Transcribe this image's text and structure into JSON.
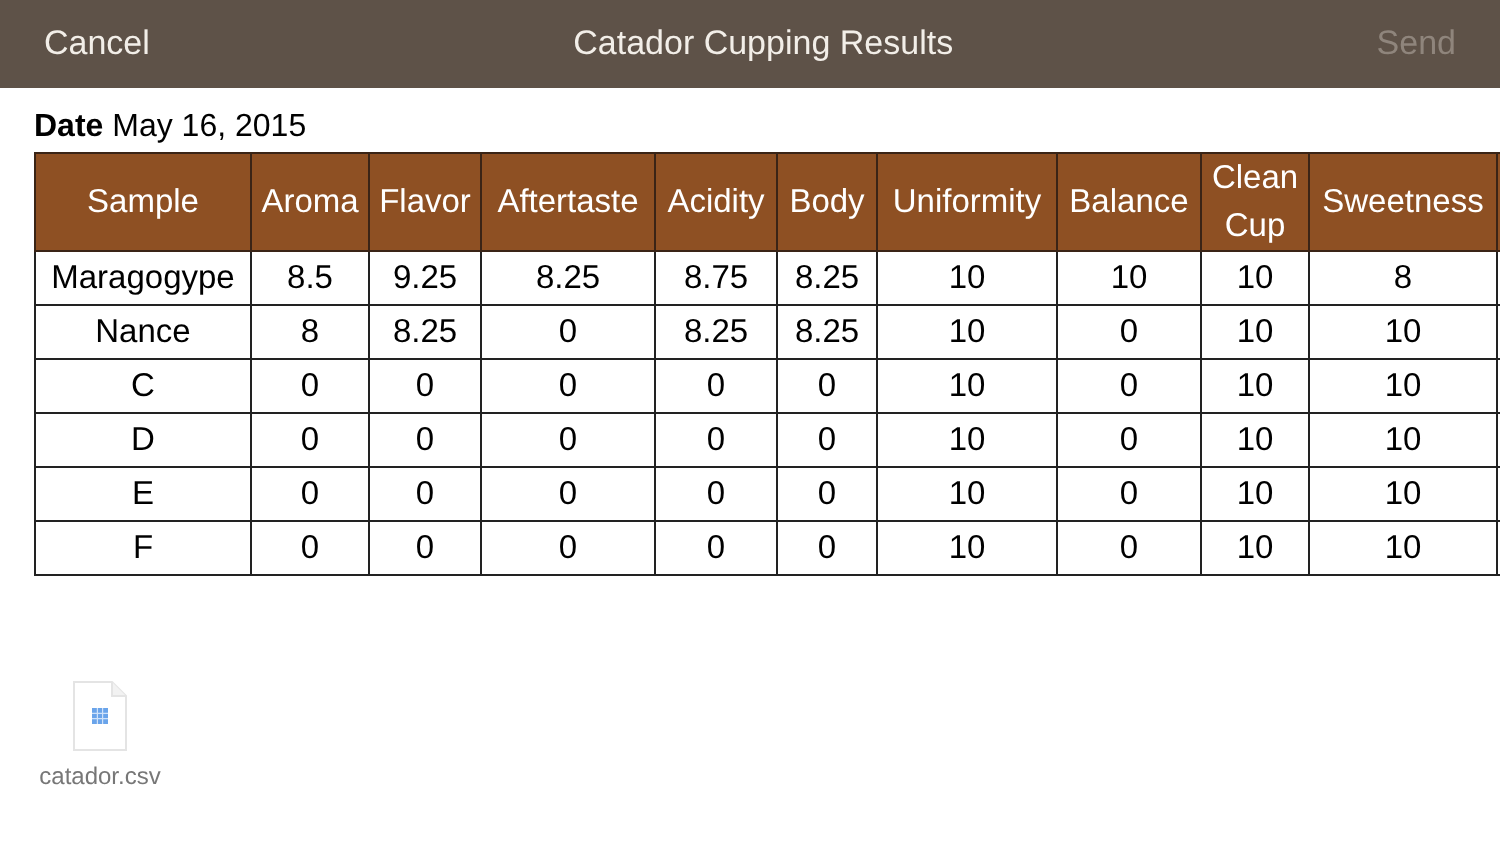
{
  "nav_bar": {
    "cancel": "Cancel",
    "title": "Catador Cupping Results",
    "send": {
      "label": "Send",
      "disabled": true
    }
  },
  "date": {
    "label": "Date",
    "value": "May 16, 2015"
  },
  "table": {
    "columns": [
      "Sample",
      "Aroma",
      "Flavor",
      "Aftertaste",
      "Acidity",
      "Body",
      "Uniformity",
      "Balance",
      "Clean Cup",
      "Sweetness"
    ],
    "rows": [
      [
        "Maragogype",
        "8.5",
        "9.25",
        "8.25",
        "8.75",
        "8.25",
        "10",
        "10",
        "10",
        "8"
      ],
      [
        "Nance",
        "8",
        "8.25",
        "0",
        "8.25",
        "8.25",
        "10",
        "0",
        "10",
        "10"
      ],
      [
        "C",
        "0",
        "0",
        "0",
        "0",
        "0",
        "10",
        "0",
        "10",
        "10"
      ],
      [
        "D",
        "0",
        "0",
        "0",
        "0",
        "0",
        "10",
        "0",
        "10",
        "10"
      ],
      [
        "E",
        "0",
        "0",
        "0",
        "0",
        "0",
        "10",
        "0",
        "10",
        "10"
      ],
      [
        "F",
        "0",
        "0",
        "0",
        "0",
        "0",
        "10",
        "0",
        "10",
        "10"
      ]
    ]
  },
  "attachment": {
    "filename": "catador.csv"
  }
}
